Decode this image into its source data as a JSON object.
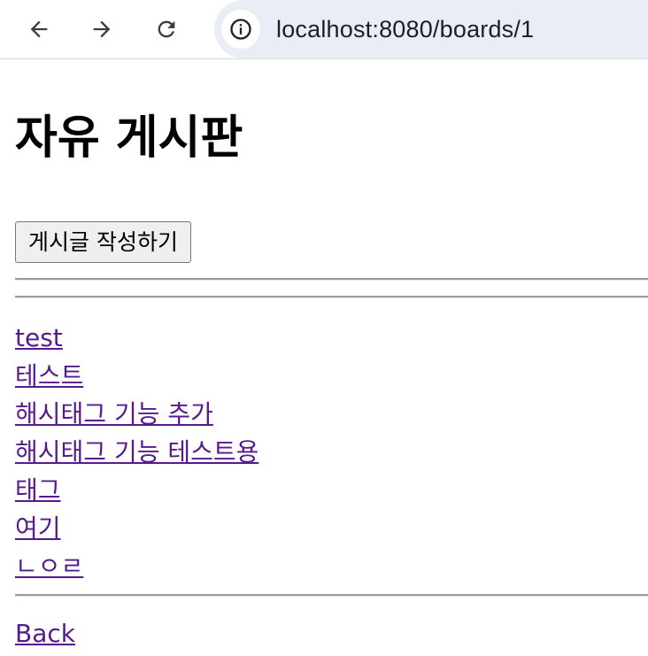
{
  "browser": {
    "url": "localhost:8080/boards/1",
    "icons": {
      "back": "arrow-left-icon",
      "forward": "arrow-right-icon",
      "reload": "reload-icon",
      "info": "info-icon"
    }
  },
  "page": {
    "title": "자유 게시판",
    "write_button_label": "게시글 작성하기",
    "posts": [
      {
        "title": "test"
      },
      {
        "title": "테스트"
      },
      {
        "title": "해시태그 기능 추가"
      },
      {
        "title": "해시태그 기능 테스트용"
      },
      {
        "title": "태그"
      },
      {
        "title": "여기"
      },
      {
        "title": "ㄴㅇㄹ"
      }
    ],
    "back_label": "Back"
  },
  "colors": {
    "visited_link": "#551a8b",
    "omnibox_bg": "#e9edf6"
  }
}
